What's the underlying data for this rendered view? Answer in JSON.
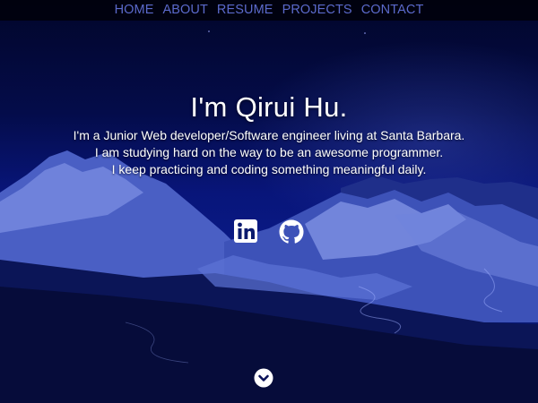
{
  "nav": {
    "items": [
      {
        "label": "HOME"
      },
      {
        "label": "ABOUT"
      },
      {
        "label": "RESUME"
      },
      {
        "label": "PROJECTS"
      },
      {
        "label": "CONTACT"
      }
    ],
    "link_color": "#5b6acb"
  },
  "hero": {
    "title": "I'm Qirui Hu.",
    "description_lines": [
      "I'm a Junior Web developer/Software engineer living at Santa Barbara.",
      "I am studying hard on the way to be an awesome programmer.",
      "I keep practicing and coding something meaningful daily."
    ]
  },
  "social": {
    "links": [
      {
        "icon": "linkedin-icon"
      },
      {
        "icon": "github-icon"
      }
    ]
  },
  "scroll": {
    "icon": "chevron-down-circle-icon"
  },
  "colors": {
    "background_top": "#02062a",
    "background_mid": "#0a1a86",
    "text": "#ffffff"
  }
}
